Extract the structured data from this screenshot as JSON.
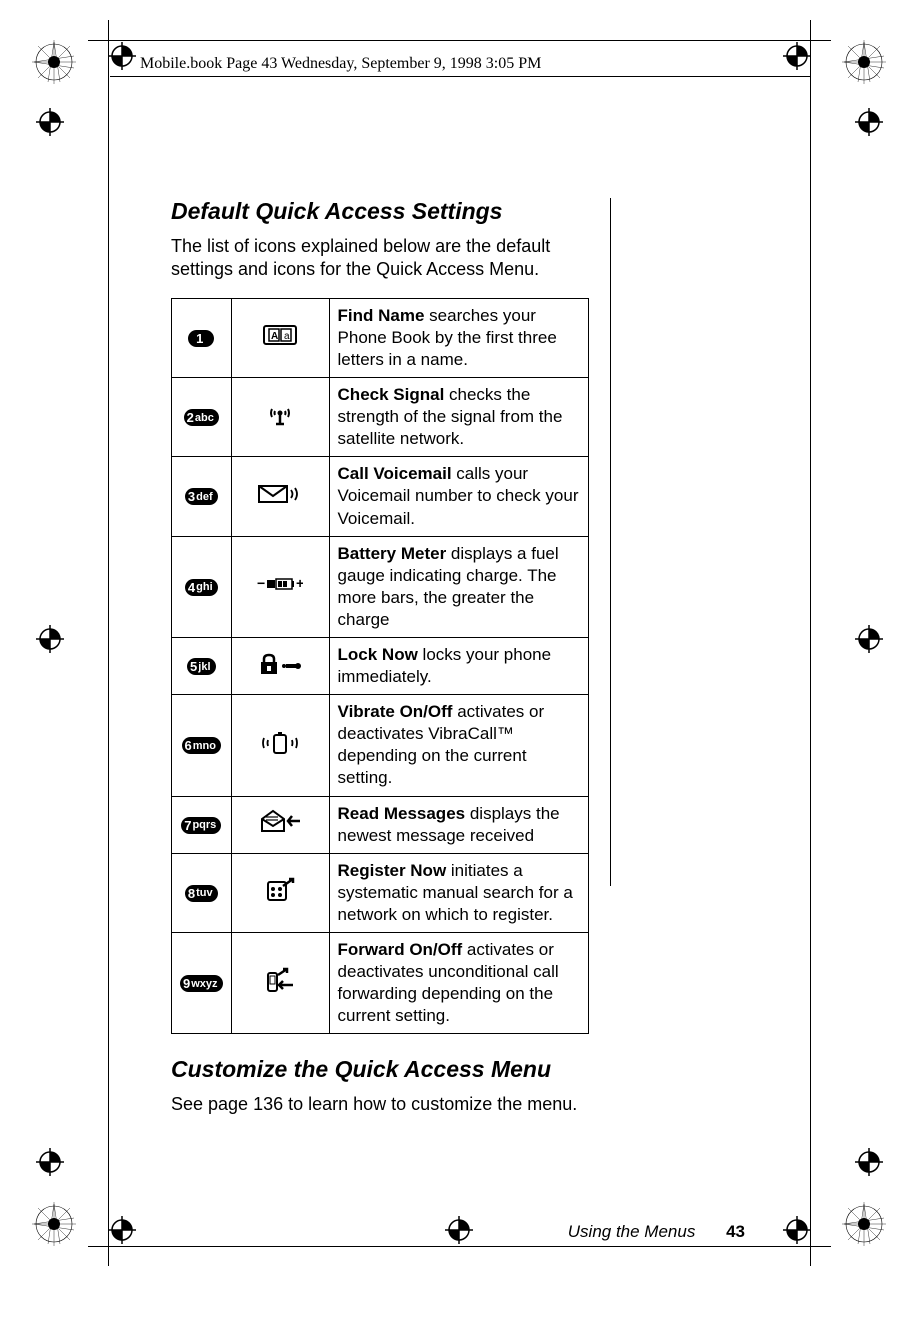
{
  "meta": {
    "header_text": "Mobile.book  Page 43  Wednesday, September 9, 1998  3:05 PM"
  },
  "section1": {
    "heading": "Default Quick Access Settings",
    "intro": "The list of icons explained below are the default settings and icons for the Quick Access Menu."
  },
  "keys": {
    "k1": {
      "num": "1",
      "letters": ""
    },
    "k2": {
      "num": "2",
      "letters": "abc"
    },
    "k3": {
      "num": "3",
      "letters": "def"
    },
    "k4": {
      "num": "4",
      "letters": "ghi"
    },
    "k5": {
      "num": "5",
      "letters": "jkl"
    },
    "k6": {
      "num": "6",
      "letters": "mno"
    },
    "k7": {
      "num": "7",
      "letters": "pqrs"
    },
    "k8": {
      "num": "8",
      "letters": "tuv"
    },
    "k9": {
      "num": "9",
      "letters": "wxyz"
    }
  },
  "rows": {
    "r1": {
      "title": "Find Name",
      "rest": " searches your Phone Book by the first three letters in a name."
    },
    "r2": {
      "title": "Check Signal",
      "rest": " checks the strength of the signal from the satellite network."
    },
    "r3": {
      "title": "Call Voicemail",
      "rest": " calls your Voicemail number to check your Voicemail."
    },
    "r4": {
      "title": "Battery Meter",
      "rest": " displays a fuel gauge indicating charge. The more bars, the greater the charge"
    },
    "r5": {
      "title": "Lock Now",
      "rest": " locks your phone immediately."
    },
    "r6": {
      "title": "Vibrate On/Off",
      "rest": " activates or deactivates VibraCall™ depending on the current setting."
    },
    "r7": {
      "title": "Read Messages",
      "rest": " displays the newest message received"
    },
    "r8": {
      "title": "Register Now",
      "rest": " initiates a systematic manual search for a network on which to register."
    },
    "r9": {
      "title": "Forward On/Off",
      "rest": " activates or deactivates unconditional call forwarding depending on the current setting."
    }
  },
  "section2": {
    "heading": "Customize the Quick Access Menu",
    "body": "See page 136 to learn how to customize the menu."
  },
  "footer": {
    "section": "Using the Menus",
    "page": "43"
  }
}
